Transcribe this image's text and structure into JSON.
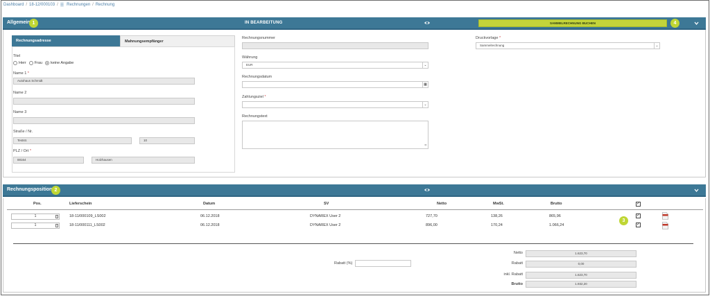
{
  "breadcrumbs": [
    {
      "label": "Dashboard"
    },
    {
      "label": "18-12/000103"
    },
    {
      "label": "Rechnungen"
    },
    {
      "label": "Rechnung"
    }
  ],
  "general_panel": {
    "title": "Allgemein",
    "badge": "1",
    "status": "IN BEARBEITUNG",
    "book_button": "SAMMELRECHNUNG BUCHEN",
    "badge_right": "4"
  },
  "tabs": [
    {
      "label": "Rechnungsadresse",
      "active": true
    },
    {
      "label": "Mahnungsempfänger",
      "active": false
    }
  ],
  "address": {
    "title_label": "Titel",
    "salutations": [
      {
        "label": "Herr",
        "selected": false
      },
      {
        "label": "Frau",
        "selected": false
      },
      {
        "label": "keine Angabe",
        "selected": true
      }
    ],
    "name1_label": "Name 1",
    "name1_value": "Autohaus Schmidt",
    "name2_label": "Name 2",
    "name2_value": "",
    "name3_label": "Name 3",
    "name3_value": "",
    "street_label": "Straße / Nr.",
    "street_value": "Teststr.",
    "number_value": "10",
    "zip_label": "PLZ / Ort",
    "zip_value": "88164",
    "city_value": "Holzhausen",
    "required_mark": "*"
  },
  "invoice": {
    "number_label": "Rechnungsnummer",
    "number_value": "",
    "currency_label": "Währung",
    "currency_value": "EUR",
    "date_label": "Rechnungsdatum",
    "date_value": "",
    "payment_label": "Zahlungsziel",
    "payment_value": "",
    "text_label": "Rechnungstext",
    "text_value": "",
    "template_label": "Druckvorlage",
    "template_value": "Sammelrechnung"
  },
  "positions_panel": {
    "title": "Rechnungspositionen",
    "badge": "2",
    "badge_table": "3"
  },
  "table": {
    "headers": {
      "pos": "Pos.",
      "delivery": "Lieferschein",
      "date": "Datum",
      "sv": "SV",
      "net": "Netto",
      "vat": "MwSt.",
      "gross": "Brutto"
    },
    "rows": [
      {
        "pos": "1",
        "delivery": "18-11/000109_LS002",
        "date": "06.12.2018",
        "sv": "DYNAREX User 2",
        "net": "727,70",
        "vat": "138,26",
        "gross": "865,96",
        "checked": true
      },
      {
        "pos": "1",
        "delivery": "18-11/000111_LS002",
        "date": "06.12.2018",
        "sv": "DYNAREX User 2",
        "net": "896,00",
        "vat": "170,24",
        "gross": "1.066,24",
        "checked": true
      }
    ],
    "header_checked": true
  },
  "summary": {
    "discount_label": "Rabatt (%)",
    "discount_value": "",
    "net_label": "Netto",
    "net_value": "1.623,70",
    "rebate_label": "Rabatt",
    "rebate_value": "0,00",
    "incl_label": "inkl. Rabatt",
    "incl_value": "1.623,70",
    "gross_label": "Brutto",
    "gross_value": "1.932,20"
  },
  "colors": {
    "panel_header": "#3d7896",
    "accent_button": "#c3d43b",
    "badge": "#bfd634"
  }
}
